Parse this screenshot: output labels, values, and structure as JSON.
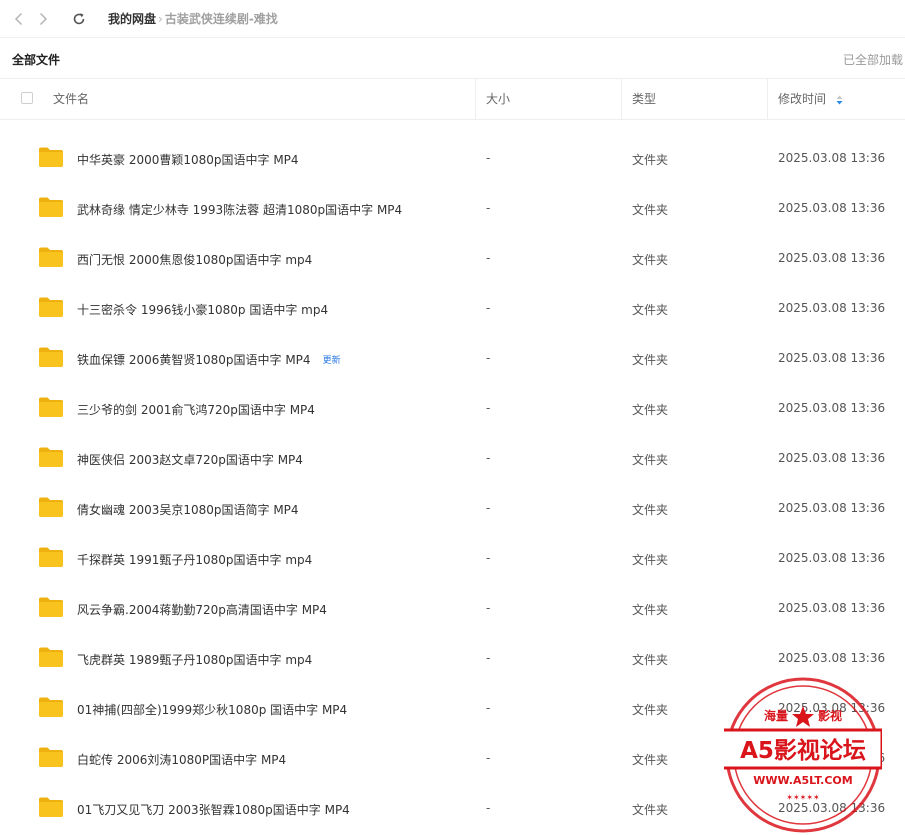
{
  "toolbar": {
    "breadcrumb_root": "我的网盘",
    "breadcrumb_sep": "›",
    "breadcrumb_current": "古装武侠连续剧-难找"
  },
  "subbar": {
    "all_files": "全部文件",
    "loaded_all": "已全部加载"
  },
  "columns": {
    "name": "文件名",
    "size": "大小",
    "type": "类型",
    "modified": "修改时间"
  },
  "rows": [
    {
      "name": "中华英豪 2000曹颖1080p国语中字 MP4",
      "badge": "",
      "size": "-",
      "type": "文件夹",
      "modified": "2025.03.08 13:36"
    },
    {
      "name": "武林奇缘 情定少林寺 1993陈法蓉 超清1080p国语中字 MP4",
      "badge": "",
      "size": "-",
      "type": "文件夹",
      "modified": "2025.03.08 13:36"
    },
    {
      "name": "西门无恨 2000焦恩俊1080p国语中字 mp4",
      "badge": "",
      "size": "-",
      "type": "文件夹",
      "modified": "2025.03.08 13:36"
    },
    {
      "name": "十三密杀令 1996钱小豪1080p 国语中字 mp4",
      "badge": "",
      "size": "-",
      "type": "文件夹",
      "modified": "2025.03.08 13:36"
    },
    {
      "name": "铁血保镖 2006黄智贤1080p国语中字 MP4",
      "badge": "更新",
      "size": "-",
      "type": "文件夹",
      "modified": "2025.03.08 13:36"
    },
    {
      "name": "三少爷的剑 2001俞飞鸿720p国语中字 MP4",
      "badge": "",
      "size": "-",
      "type": "文件夹",
      "modified": "2025.03.08 13:36"
    },
    {
      "name": "神医侠侣 2003赵文卓720p国语中字 MP4",
      "badge": "",
      "size": "-",
      "type": "文件夹",
      "modified": "2025.03.08 13:36"
    },
    {
      "name": "倩女幽魂 2003吴京1080p国语简字 MP4",
      "badge": "",
      "size": "-",
      "type": "文件夹",
      "modified": "2025.03.08 13:36"
    },
    {
      "name": "千探群英 1991甄子丹1080p国语中字 mp4",
      "badge": "",
      "size": "-",
      "type": "文件夹",
      "modified": "2025.03.08 13:36"
    },
    {
      "name": "风云争霸.2004蒋勤勤720p高清国语中字 MP4",
      "badge": "",
      "size": "-",
      "type": "文件夹",
      "modified": "2025.03.08 13:36"
    },
    {
      "name": "飞虎群英 1989甄子丹1080p国语中字 mp4",
      "badge": "",
      "size": "-",
      "type": "文件夹",
      "modified": "2025.03.08 13:36"
    },
    {
      "name": "01神捕(四部全)1999郑少秋1080p 国语中字 MP4",
      "badge": "",
      "size": "-",
      "type": "文件夹",
      "modified": "2025.03.08 13:36"
    },
    {
      "name": "白蛇传 2006刘涛1080P国语中字 MP4",
      "badge": "",
      "size": "-",
      "type": "文件夹",
      "modified": "2025.03.08 13:36"
    },
    {
      "name": "01飞刀又见飞刀 2003张智霖1080p国语中字 MP4",
      "badge": "",
      "size": "-",
      "type": "文件夹",
      "modified": "2025.03.08 13:36"
    }
  ],
  "watermark": {
    "top_left": "海量",
    "top_right": "影视",
    "main": "A5影视论坛",
    "url": "WWW.A5LT.COM"
  },
  "colors": {
    "folder": "#f8c31c",
    "folder_back": "#eeb10f",
    "badge": "#2a7ae2",
    "sort_active": "#2a8ae6",
    "watermark_red": "#d9141b"
  },
  "icons": {
    "back": "chevron-left-icon",
    "forward": "chevron-right-icon",
    "refresh": "refresh-icon",
    "folder": "folder-icon",
    "sort": "sort-icon"
  }
}
